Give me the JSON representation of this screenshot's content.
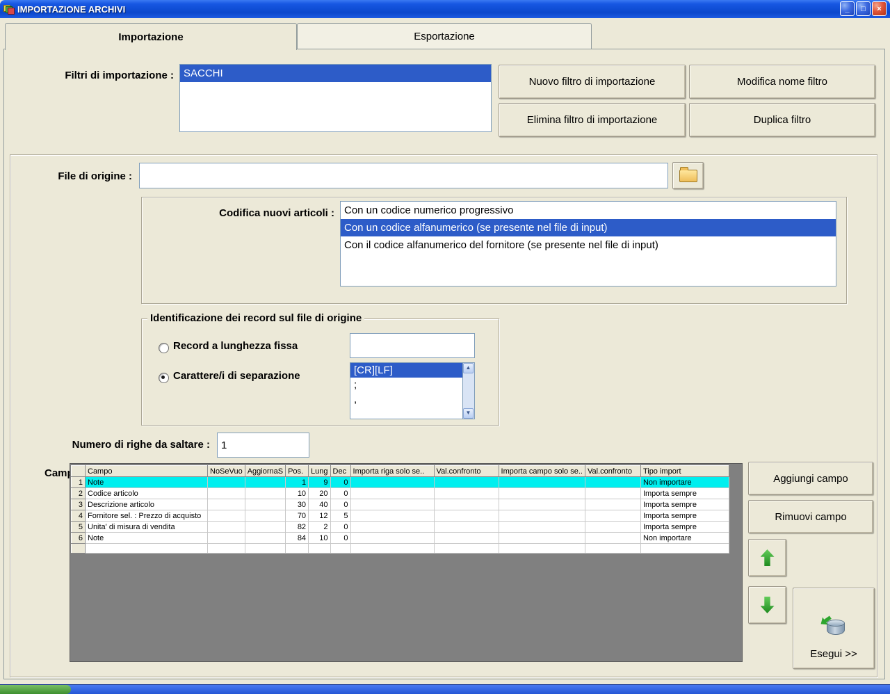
{
  "titlebar": {
    "title": "IMPORTAZIONE ARCHIVI"
  },
  "window_controls": {
    "minimize": "_",
    "maximize": "□",
    "close": "×"
  },
  "tabs": {
    "importazione": "Importazione",
    "esportazione": "Esportazione"
  },
  "filtri": {
    "label": "Filtri di importazione :",
    "items": [
      "SACCHI"
    ],
    "selected": "SACCHI",
    "buttons": {
      "nuovo": "Nuovo filtro di importazione",
      "modifica": "Modifica nome filtro",
      "elimina": "Elimina filtro di importazione",
      "duplica": "Duplica filtro"
    }
  },
  "file_origine": {
    "label": "File di origine :",
    "value": ""
  },
  "codifica": {
    "label": "Codifica nuovi articoli :",
    "options": [
      "Con un codice numerico progressivo",
      "Con un codice alfanumerico (se presente nel file di input)",
      "Con il codice alfanumerico del fornitore (se presente nel file di input)"
    ],
    "selected": "Con un codice alfanumerico (se presente nel file di input)"
  },
  "identificazione": {
    "title": "Identificazione dei record sul file di origine",
    "record_lunghezza_fissa": {
      "label": "Record a lunghezza fissa",
      "checked": false,
      "value": ""
    },
    "carattere_separazione": {
      "label": "Carattere/i di separazione",
      "checked": true,
      "options": [
        "[CR][LF]",
        ";",
        ","
      ],
      "selected": "[CR][LF]"
    }
  },
  "righe_da_saltare": {
    "label": "Numero di righe da saltare :",
    "value": "1"
  },
  "campi": {
    "label": "Campi :",
    "header": [
      "Campo",
      "NoSeVuo",
      "AggiornaS",
      "Pos.",
      "Lung",
      "Dec",
      "Importa riga solo se..",
      "Val.confronto",
      "Importa campo solo se..",
      "Val.confronto",
      "Tipo import"
    ],
    "rows": [
      {
        "n": "1",
        "campo": "Note",
        "pos": "1",
        "lung": "9",
        "dec": "0",
        "tipo": "Non importare"
      },
      {
        "n": "2",
        "campo": "Codice articolo",
        "pos": "10",
        "lung": "20",
        "dec": "0",
        "tipo": "Importa sempre"
      },
      {
        "n": "3",
        "campo": "Descrizione articolo",
        "pos": "30",
        "lung": "40",
        "dec": "0",
        "tipo": "Importa sempre"
      },
      {
        "n": "4",
        "campo": "Fornitore sel. : Prezzo di acquisto",
        "pos": "70",
        "lung": "12",
        "dec": "5",
        "tipo": "Importa sempre"
      },
      {
        "n": "5",
        "campo": "Unita' di misura di vendita",
        "pos": "82",
        "lung": "2",
        "dec": "0",
        "tipo": "Importa sempre"
      },
      {
        "n": "6",
        "campo": "Note",
        "pos": "84",
        "lung": "10",
        "dec": "0",
        "tipo": "Non importare"
      }
    ],
    "buttons": {
      "aggiungi": "Aggiungi campo",
      "rimuovi": "Rimuovi campo",
      "esegui": "Esegui >>"
    }
  },
  "icons": {
    "scroll_up": "▲",
    "scroll_down": "▼"
  }
}
